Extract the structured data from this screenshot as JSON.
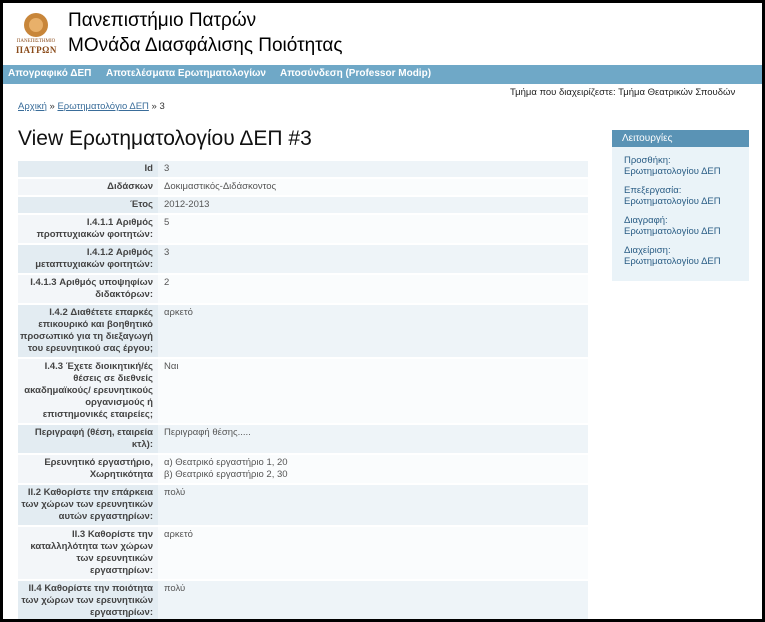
{
  "header": {
    "logo_small_text": "ΠΑΝΕΠΙΣΤΗΜΙΟ",
    "logo_big_text": "ΠΑΤΡΩΝ",
    "title_line1": "Πανεπιστήμιο Πατρών",
    "title_line2": "ΜΟνάδα Διασφάλισης Ποιότητας"
  },
  "nav": {
    "items": [
      {
        "label": "Απογραφικό ΔΕΠ"
      },
      {
        "label": "Αποτελέσματα Ερωτηματολογίων"
      },
      {
        "label": "Αποσύνδεση (Professor Modip)"
      }
    ]
  },
  "department_text": "Τμήμα που διαχειρίζεστε: Τμήμα Θεατρικών Σπουδών",
  "breadcrumb": {
    "home": "Αρχική",
    "sep1": "»",
    "questionnaire": "Ερωτηματολόγιο ΔΕΠ",
    "sep2": "»",
    "current": "3"
  },
  "page_title": "View Ερωτηματολογίου ΔΕΠ #3",
  "details": {
    "rows": [
      {
        "label": "Id",
        "value": "3"
      },
      {
        "label": "Διδάσκων",
        "value": "Δοκιμαστικός-Διδάσκοντος"
      },
      {
        "label": "Έτος",
        "value": "2012-2013"
      },
      {
        "label": "I.4.1.1 Αριθμός προπτυχιακών φοιτητών:",
        "value": "5"
      },
      {
        "label": "I.4.1.2 Αριθμός μεταπτυχιακών φοιτητών:",
        "value": "3"
      },
      {
        "label": "I.4.1.3 Αριθμός υποψηφίων διδακτόρων:",
        "value": "2"
      },
      {
        "label": "I.4.2 Διαθέτετε επαρκές επικουρικό και βοηθητικό προσωπικό για τη διεξαγωγή του ερευνητικού σας έργου;",
        "value": "αρκετό"
      },
      {
        "label": "I.4.3 Έχετε διοικητική/ές θέσεις σε διεθνείς ακαδημαϊκούς/ ερευνητικούς οργανισμούς ή επιστημονικές εταιρείες;",
        "value": "Ναι"
      },
      {
        "label": "Περιγραφή (θέση, εταιρεία κτλ):",
        "value": "Περιγραφή θέσης....."
      },
      {
        "label": "Ερευνητικό εργαστήριο, Χωρητικότητα",
        "value": "α) Θεατρικό εργαστήριο 1, 20\nβ) Θεατρικό εργαστήριο 2, 30"
      },
      {
        "label": "II.2 Καθορίστε την επάρκεια των χώρων των ερευνητικών αυτών εργαστηρίων:",
        "value": "πολύ"
      },
      {
        "label": "II.3 Καθορίστε την καταλληλότητα των χώρων των ερευνητικών εργαστηρίων:",
        "value": "αρκετό"
      },
      {
        "label": "II.4 Καθορίστε την ποιότητα των χώρων των ερευνητικών εργαστηρίων:",
        "value": "πολύ"
      }
    ]
  },
  "sidebar": {
    "title": "Λειτουργίες",
    "items": [
      {
        "label": "Προσθήκη: Ερωτηματολογίου ΔΕΠ"
      },
      {
        "label": "Επεξεργασία: Ερωτηματολογίου ΔΕΠ"
      },
      {
        "label": "Διαγραφή: Ερωτηματολογίου ΔΕΠ"
      },
      {
        "label": "Διαχείριση: Ερωτηματολογίου ΔΕΠ"
      }
    ]
  }
}
